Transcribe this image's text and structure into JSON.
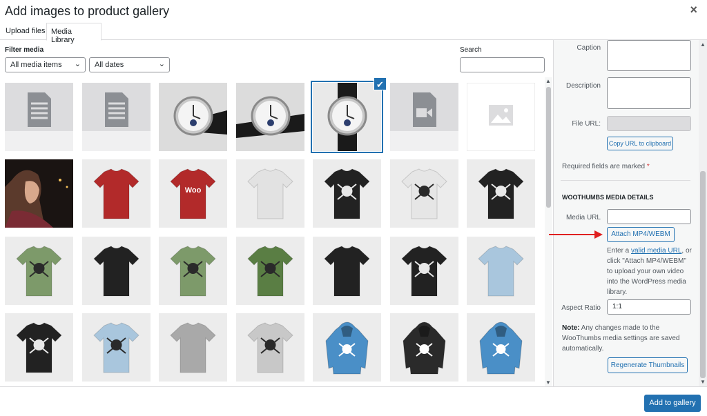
{
  "header": {
    "title": "Add images to product gallery",
    "close_glyph": "×"
  },
  "tabs": [
    {
      "label": "Upload files"
    },
    {
      "label": "Media Library",
      "active": true
    }
  ],
  "filters": {
    "label": "Filter media",
    "type_value": "All media items",
    "date_value": "All dates",
    "search_label": "Search",
    "search_value": ""
  },
  "attachments": [
    {
      "kind": "document"
    },
    {
      "kind": "document"
    },
    {
      "kind": "watch-back"
    },
    {
      "kind": "watch-strap"
    },
    {
      "kind": "watch-front",
      "selected": true
    },
    {
      "kind": "video"
    },
    {
      "kind": "image-placeholder"
    },
    {
      "kind": "photo-portrait"
    },
    {
      "kind": "tshirt",
      "color": "#b22a2a"
    },
    {
      "kind": "tshirt",
      "color": "#b22a2a",
      "logo": "Woo"
    },
    {
      "kind": "tshirt",
      "color": "#e2e2e2"
    },
    {
      "kind": "tshirt",
      "color": "#222222",
      "skull": true
    },
    {
      "kind": "tshirt",
      "color": "#e6e6e6",
      "skull": true
    },
    {
      "kind": "tshirt",
      "color": "#222222",
      "skull": true
    },
    {
      "kind": "tshirt",
      "color": "#7d9a6a",
      "skull": true
    },
    {
      "kind": "tshirt",
      "color": "#222222"
    },
    {
      "kind": "tshirt",
      "color": "#7d9a6a",
      "skull": true
    },
    {
      "kind": "tshirt",
      "color": "#5a7e44",
      "skull": true
    },
    {
      "kind": "tshirt",
      "color": "#222222"
    },
    {
      "kind": "tshirt",
      "color": "#222222",
      "skull": true
    },
    {
      "kind": "tshirt",
      "color": "#a9c6dd"
    },
    {
      "kind": "tshirt",
      "color": "#222222",
      "skull": true
    },
    {
      "kind": "tshirt",
      "color": "#a9c6dd",
      "skull": true
    },
    {
      "kind": "tshirt",
      "color": "#a9a9a9"
    },
    {
      "kind": "tshirt",
      "color": "#c8c8c8",
      "skull": true
    },
    {
      "kind": "hoodie",
      "color": "#4a8fc7"
    },
    {
      "kind": "hoodie",
      "color": "#2a2a2a"
    },
    {
      "kind": "hoodie",
      "color": "#4a8fc7"
    }
  ],
  "details": {
    "caption_label": "Caption",
    "description_label": "Description",
    "file_url_label": "File URL:",
    "copy_button": "Copy URL to clipboard",
    "required_text": "Required fields are marked",
    "required_mark": "*"
  },
  "woothumbs": {
    "heading": "WOOTHUMBS MEDIA DETAILS",
    "media_url_label": "Media URL",
    "media_url_value": "",
    "attach_button": "Attach MP4/WEBM",
    "help_prefix": "Enter a",
    "help_link": "valid media URL",
    "help_suffix": ", or click \"Attach MP4/WEBM\" to upload your own video into the WordPress media library.",
    "aspect_label": "Aspect Ratio",
    "aspect_value": "1:1",
    "note_label": "Note:",
    "note_text": "Any changes made to the WooThumbs media settings are saved automatically.",
    "regen_button": "Regenerate Thumbnails"
  },
  "footer": {
    "primary_button": "Add to gallery"
  },
  "colors": {
    "accent": "#2271b1",
    "arrow": "#e02020"
  }
}
